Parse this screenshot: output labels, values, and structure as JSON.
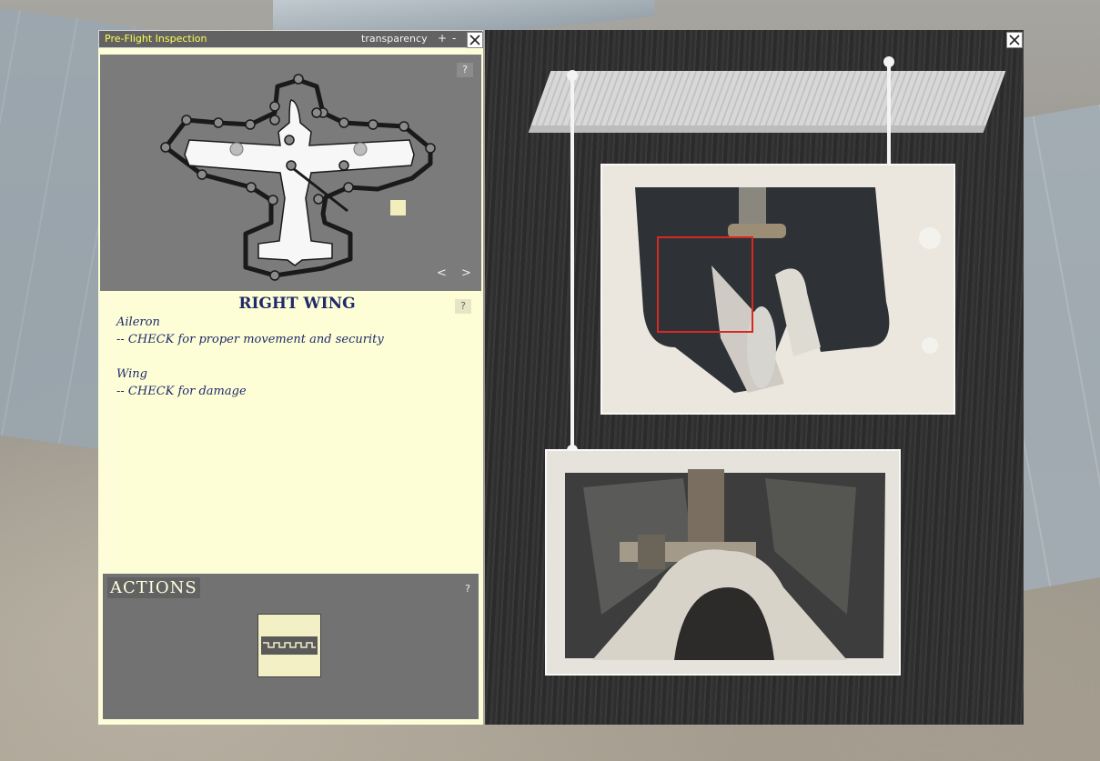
{
  "window": {
    "title": "Pre-Flight Inspection",
    "transparency_label": "transparency",
    "plus": "+",
    "minus": "-"
  },
  "map": {
    "help": "?",
    "prev": "<",
    "next": ">"
  },
  "checklist": {
    "section_title": "RIGHT WING",
    "help": "?",
    "items": [
      {
        "name": "Aileron",
        "action": "-- CHECK for proper movement and security"
      },
      {
        "name": "Wing",
        "action": "-- CHECK for damage"
      }
    ]
  },
  "actions": {
    "title": "ACTIONS",
    "help": "?"
  },
  "colors": {
    "title_text": "#ffff55",
    "checklist_bg": "#fefed6",
    "checklist_text": "#1f2a6a",
    "highlight": "#d9281f"
  },
  "icons": {
    "close": "close-icon",
    "action": "control-lock-icon"
  }
}
